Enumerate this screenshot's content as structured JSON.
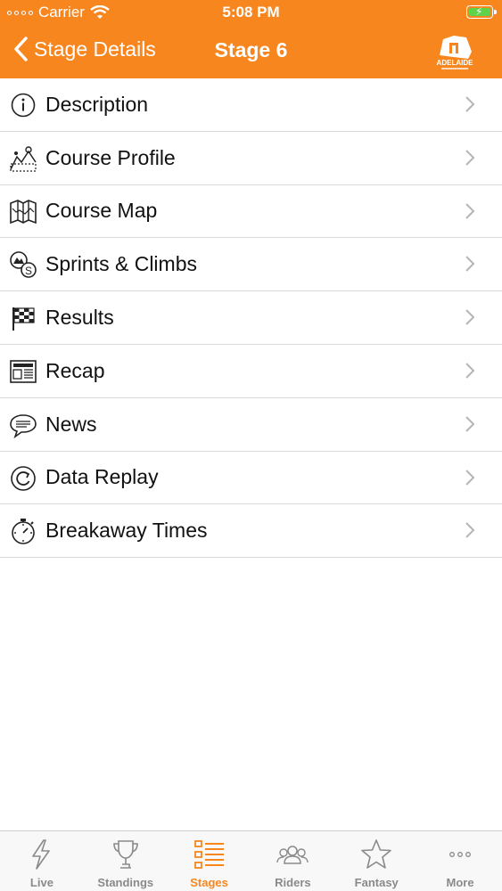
{
  "status_bar": {
    "carrier": "Carrier",
    "time": "5:08 PM"
  },
  "nav": {
    "back_label": "Stage Details",
    "title": "Stage 6",
    "logo_text": "ADELAIDE"
  },
  "menu": {
    "items": [
      {
        "label": "Description",
        "icon": "info-icon"
      },
      {
        "label": "Course Profile",
        "icon": "course-profile-icon"
      },
      {
        "label": "Course Map",
        "icon": "map-icon"
      },
      {
        "label": "Sprints & Climbs",
        "icon": "sprints-climbs-icon"
      },
      {
        "label": "Results",
        "icon": "checkered-flag-icon"
      },
      {
        "label": "Recap",
        "icon": "newspaper-icon"
      },
      {
        "label": "News",
        "icon": "speech-bubble-icon"
      },
      {
        "label": "Data Replay",
        "icon": "replay-icon"
      },
      {
        "label": "Breakaway Times",
        "icon": "stopwatch-icon"
      }
    ]
  },
  "tabs": [
    {
      "label": "Live",
      "icon": "lightning-icon"
    },
    {
      "label": "Standings",
      "icon": "trophy-icon"
    },
    {
      "label": "Stages",
      "icon": "list-icon",
      "active": true
    },
    {
      "label": "Riders",
      "icon": "riders-icon"
    },
    {
      "label": "Fantasy",
      "icon": "star-icon"
    },
    {
      "label": "More",
      "icon": "more-icon"
    }
  ],
  "colors": {
    "accent": "#f7861f",
    "inactive": "#8a8a8a",
    "battery": "#5fd14a"
  }
}
